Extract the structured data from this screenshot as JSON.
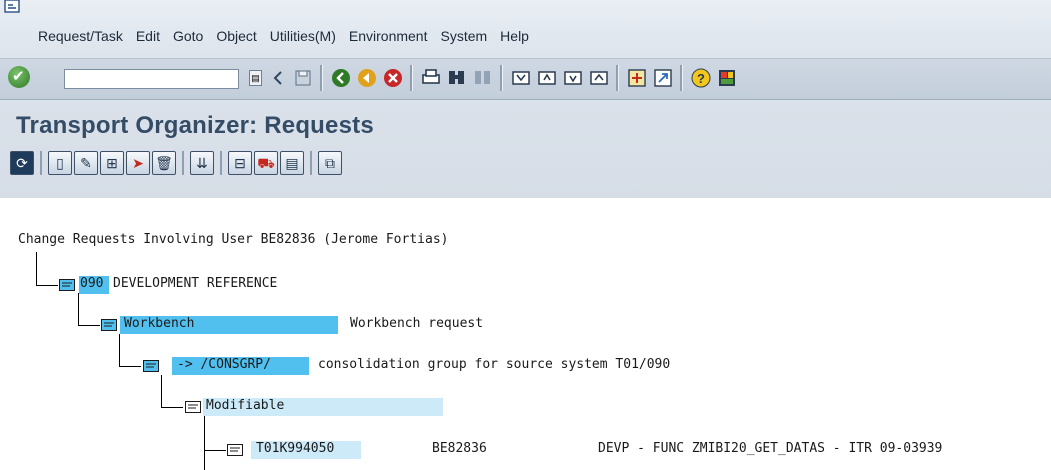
{
  "window": {
    "menu": [
      "Request/Task",
      "Edit",
      "Goto",
      "Object",
      "Utilities(M)",
      "Environment",
      "System",
      "Help"
    ],
    "command_field": {
      "value": ""
    }
  },
  "title": "Transport Organizer: Requests",
  "tree": {
    "header": "Change Requests Involving User BE82836 (Jerome Fortias)",
    "nodes": [
      {
        "label": "090",
        "text": "DEVELOPMENT REFERENCE"
      },
      {
        "label": "Workbench",
        "text": "Workbench request"
      },
      {
        "label": "-> /CONSGRP/",
        "text": "consolidation group for source system T01/090"
      },
      {
        "label": "Modifiable",
        "text": ""
      },
      {
        "label": "T01K994050",
        "owner": "BE82836",
        "text": "DEVP - FUNC ZMIBI20_GET_DATAS - ITR 09-03939"
      }
    ]
  },
  "colors": {
    "highlight": "#52c0ef",
    "highlight_light": "#cdeaf9",
    "title": "#344c66",
    "frame": "#dde4ec"
  }
}
